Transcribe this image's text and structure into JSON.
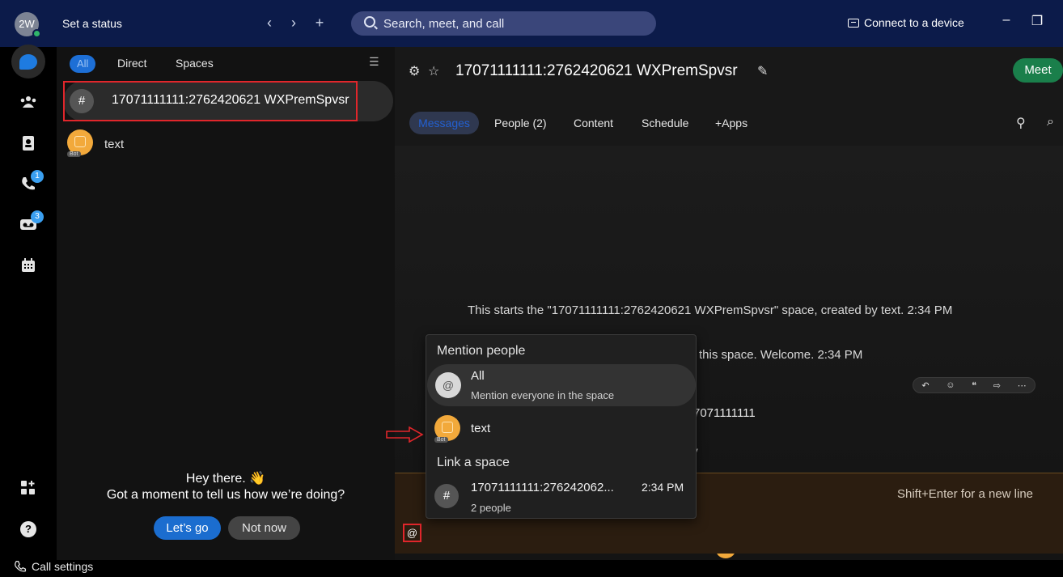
{
  "titlebar": {
    "avatar_initials": "2W",
    "status_label": "Set a status",
    "back": "‹",
    "forward": "›",
    "new": "+",
    "search_placeholder": "Search, meet, and call",
    "connect_label": "Connect to a device",
    "minimize": "–",
    "restore": "❐"
  },
  "rail": {
    "calls_badge": "1",
    "voicemail_badge": "3",
    "help": "?",
    "call_settings": "Call settings"
  },
  "sidebar": {
    "filters": [
      "All",
      "Direct",
      "Spaces"
    ],
    "items": [
      {
        "avatar": "#",
        "name": "17071111111:2762420621 WXPremSpvsr"
      },
      {
        "avatar_tag": "Bot",
        "name": "text"
      }
    ],
    "survey": {
      "title": "Hey there. 👋",
      "subtitle": "Got a moment to tell us how we’re doing?",
      "primary": "Let’s go",
      "secondary": "Not now"
    }
  },
  "main": {
    "title": "17071111111:2762420621 WXPremSpvsr",
    "meet": "Meet",
    "tabs": [
      "Messages",
      "People (2)",
      "Content",
      "Schedule",
      "+Apps"
    ],
    "system_message": "This starts the \"17071111111:2762420621 WXPremSpvsr\" space, created by text. 2:34 PM",
    "system_message2": "this space. Welcome. 2:34 PM",
    "message_partial": "7071111111",
    "by_partial": "by",
    "composer_hint": "Shift+Enter for a new line",
    "composer_at": "@"
  },
  "mention_popup": {
    "section_people": "Mention people",
    "all_title": "All",
    "all_sub": "Mention everyone in the space",
    "person_name": "text",
    "person_tag": "Bot",
    "section_space": "Link a space",
    "space_name": "17071111111:276242062...",
    "space_time": "2:34 PM",
    "space_sub": "2 people"
  },
  "colors": {
    "titlebar": "#0c1b4a",
    "accent_blue": "#1b6dcf",
    "meet_green": "#1a7f4b",
    "annotation_red": "#e0262b"
  }
}
